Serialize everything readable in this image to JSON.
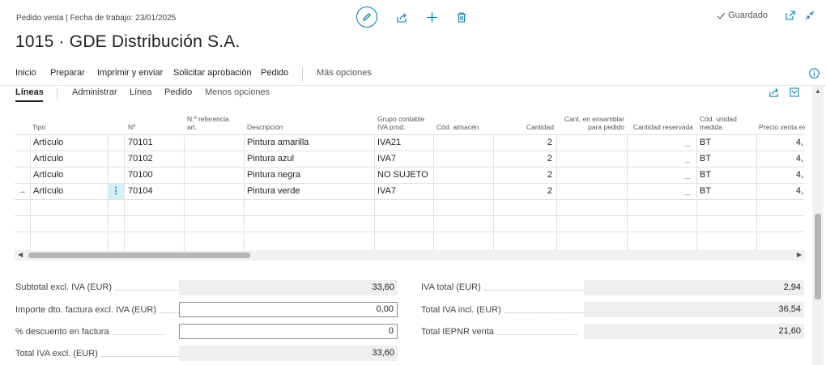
{
  "header": {
    "meta": "Pedido venta | Fecha de trabajo: 23/01/2025",
    "title": "1015 · GDE Distribución S.A.",
    "status": "Guardado"
  },
  "actions": [
    "Inicio",
    "Preparar",
    "Imprimir y enviar",
    "Solicitar aprobación",
    "Pedido",
    "Más opciones"
  ],
  "lines_section": {
    "title": "Líneas",
    "actions": [
      "Administrar",
      "Línea",
      "Pedido",
      "Menos opciones"
    ]
  },
  "table": {
    "headers": {
      "tipo": "Tipo",
      "no": "Nº",
      "ref": "N.º referencia art.",
      "desc": "Descripción",
      "grupo": "Grupo contable IVA prod.",
      "alm": "Cód. almacén",
      "cant": "Cantidad",
      "ens": "Cant. en ensamblar para pedido",
      "res": "Cantidad reservada",
      "unidad": "Cód. unidad medida",
      "precio": "Precio venta excl. IVA"
    },
    "rows": [
      {
        "tipo": "Artículo",
        "no": "70101",
        "desc": "Pintura amarilla",
        "grupo": "IVA21",
        "cant": "2",
        "res": "_",
        "unidad": "BT",
        "precio": "4,"
      },
      {
        "tipo": "Artículo",
        "no": "70102",
        "desc": "Pintura azul",
        "grupo": "IVA7",
        "cant": "2",
        "res": "_",
        "unidad": "BT",
        "precio": "4,"
      },
      {
        "tipo": "Artículo",
        "no": "70100",
        "desc": "Pintura negra",
        "grupo": "NO SUJETO",
        "cant": "2",
        "res": "_",
        "unidad": "BT",
        "precio": "4,"
      },
      {
        "tipo": "Artículo",
        "no": "70104",
        "desc": "Pintura verde",
        "grupo": "IVA7",
        "cant": "2",
        "res": "_",
        "unidad": "BT",
        "precio": "4,"
      }
    ]
  },
  "totals": {
    "subtotal_label": "Subtotal excl. IVA (EUR)",
    "subtotal_value": "33,60",
    "dto_label": "Importe dto. factura excl. IVA (EUR)",
    "dto_value": "0,00",
    "pct_label": "% descuento en factura",
    "pct_value": "0",
    "total_excl_label": "Total IVA excl. (EUR)",
    "total_excl_value": "33,60",
    "iva_total_label": "IVA total (EUR)",
    "iva_total_value": "2,94",
    "total_incl_label": "Total IVA incl. (EUR)",
    "total_incl_value": "36,54",
    "iepnr_label": "Total IEPNR venta",
    "iepnr_value": "21,60"
  }
}
